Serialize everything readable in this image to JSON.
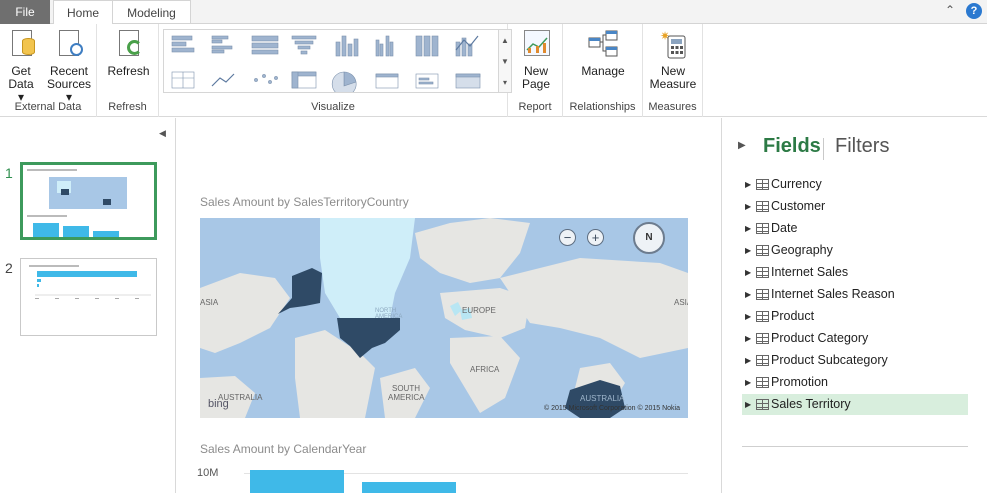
{
  "tabs": {
    "file": "File",
    "home": "Home",
    "modeling": "Modeling"
  },
  "window": {
    "collapse_icon": "chevron-up-icon",
    "help": "?"
  },
  "ribbon": {
    "external_data": {
      "label": "External Data",
      "get_data_line1": "Get",
      "get_data_line2": "Data ▾",
      "recent_sources_line1": "Recent",
      "recent_sources_line2": "Sources ▾"
    },
    "refresh": {
      "label": "Refresh",
      "button": "Refresh"
    },
    "visualize": {
      "label": "Visualize"
    },
    "report": {
      "label": "Report",
      "new_page_line1": "New",
      "new_page_line2": "Page"
    },
    "relationships": {
      "label": "Relationships",
      "manage": "Manage"
    },
    "measures": {
      "label": "Measures",
      "new_measure_line1": "New",
      "new_measure_line2": "Measure"
    }
  },
  "pages": {
    "items": [
      {
        "number": "1",
        "active": true
      },
      {
        "number": "2",
        "active": false
      }
    ]
  },
  "canvas": {
    "map_title": "Sales Amount by SalesTerritoryCountry",
    "map_labels": {
      "asia_left": "ASIA",
      "north_america": "NORTH AMERICA",
      "europe": "EUROPE",
      "asia_right": "ASIA",
      "africa": "AFRICA",
      "south_america": "SOUTH AMERICA",
      "australia_left": "AUSTRALIA",
      "australia": "AUSTRALIA"
    },
    "map_zoom_out": "−",
    "map_zoom_in": "+",
    "map_compass": "N",
    "bing": "bing",
    "copyright": "© 2015 Microsoft Corporation   © 2015 Nokia",
    "bar_title": "Sales Amount by CalendarYear",
    "bar_ytick": "10M"
  },
  "fields_pane": {
    "fields_tab": "Fields",
    "filters_tab": "Filters",
    "tables": [
      "Currency",
      "Customer",
      "Date",
      "Geography",
      "Internet Sales",
      "Internet Sales Reason",
      "Product",
      "Product Category",
      "Product Subcategory",
      "Promotion",
      "Sales Territory"
    ],
    "selected": "Sales Territory"
  },
  "colors": {
    "accent_green": "#3d9a5c",
    "bar_blue": "#3fb9e8",
    "map_highlight": "#2f4a66",
    "map_light": "#cfeef9"
  }
}
